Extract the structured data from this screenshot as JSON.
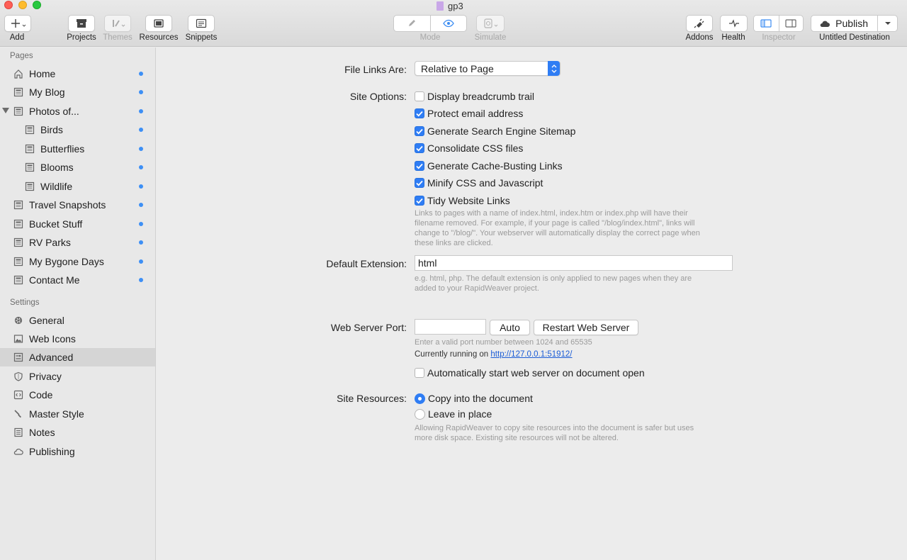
{
  "window": {
    "title": "gp3"
  },
  "toolbar": {
    "add": "Add",
    "projects": "Projects",
    "themes": "Themes",
    "resources": "Resources",
    "snippets": "Snippets",
    "mode": "Mode",
    "simulate": "Simulate",
    "addons": "Addons",
    "health": "Health",
    "inspector": "Inspector",
    "publish": "Publish",
    "destination": "Untitled Destination"
  },
  "sidebar": {
    "pages_heading": "Pages",
    "pages": [
      {
        "label": "Home",
        "icon": "home-icon"
      },
      {
        "label": "My Blog",
        "icon": "page-icon"
      },
      {
        "label": "Photos of...",
        "icon": "page-icon"
      },
      {
        "label": "Birds",
        "icon": "page-icon"
      },
      {
        "label": "Butterflies",
        "icon": "page-icon"
      },
      {
        "label": "Blooms",
        "icon": "page-icon"
      },
      {
        "label": "Wildlife",
        "icon": "page-icon"
      },
      {
        "label": "Travel Snapshots",
        "icon": "page-icon"
      },
      {
        "label": "Bucket Stuff",
        "icon": "page-icon"
      },
      {
        "label": "RV Parks",
        "icon": "page-icon"
      },
      {
        "label": "My Bygone Days",
        "icon": "page-icon"
      },
      {
        "label": "Contact Me",
        "icon": "page-icon"
      }
    ],
    "settings_heading": "Settings",
    "settings": [
      {
        "label": "General",
        "icon": "gear-icon"
      },
      {
        "label": "Web Icons",
        "icon": "image-icon"
      },
      {
        "label": "Advanced",
        "icon": "advanced-icon"
      },
      {
        "label": "Privacy",
        "icon": "shield-icon"
      },
      {
        "label": "Code",
        "icon": "code-icon"
      },
      {
        "label": "Master Style",
        "icon": "brush-icon"
      },
      {
        "label": "Notes",
        "icon": "notes-icon"
      },
      {
        "label": "Publishing",
        "icon": "cloud-icon"
      }
    ]
  },
  "main": {
    "file_links_label": "File Links Are:",
    "file_links_value": "Relative to Page",
    "site_options_label": "Site Options:",
    "options": [
      {
        "label": "Display breadcrumb trail",
        "checked": false
      },
      {
        "label": "Protect email address",
        "checked": true
      },
      {
        "label": "Generate Search Engine Sitemap",
        "checked": true
      },
      {
        "label": "Consolidate CSS files",
        "checked": true
      },
      {
        "label": "Generate Cache-Busting Links",
        "checked": true
      },
      {
        "label": "Minify CSS and Javascript",
        "checked": true
      },
      {
        "label": "Tidy Website Links",
        "checked": true
      }
    ],
    "tidy_help": [
      "Links to pages with a name of index.html, index.htm or index.php will have their",
      "filename removed. For example, if your page is called \"/blog/index.html\", links will",
      "change to \"/blog/\". Your webserver will automatically display the correct page when",
      "these links are clicked."
    ],
    "default_ext_label": "Default Extension:",
    "default_ext_value": "html",
    "ext_help": [
      "e.g. html, php. The default extension is only applied to new pages when they are",
      "added to your RapidWeaver project."
    ],
    "web_server_port_label": "Web Server Port:",
    "port_value": "",
    "auto_button": "Auto",
    "restart_button": "Restart Web Server",
    "port_help": "Enter a valid port number between 1024 and 65535",
    "running_prefix": "Currently running on ",
    "running_url": "http://127.0.0.1:51912/",
    "auto_start_label": "Automatically start web server on document open",
    "auto_start_checked": false,
    "site_resources_label": "Site Resources:",
    "resources_options": [
      {
        "label": "Copy into the document",
        "selected": true
      },
      {
        "label": "Leave in place",
        "selected": false
      }
    ],
    "resources_help": [
      "Allowing RapidWeaver to copy site resources into the document is safer but uses",
      "more disk space. Existing site resources will not be altered."
    ]
  }
}
